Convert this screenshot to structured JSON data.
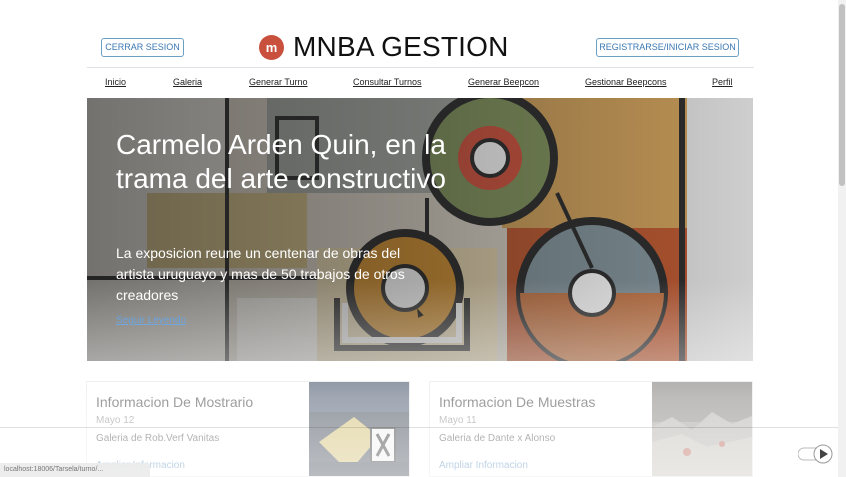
{
  "header": {
    "logout_label": "CERRAR SESION",
    "brand_logo": "m",
    "brand_title": "MNBA GESTION",
    "register_label": "REGISTRARSE/INICIAR SESION"
  },
  "nav": {
    "items": [
      {
        "label": "Inicio"
      },
      {
        "label": "Galeria"
      },
      {
        "label": "Generar Turno"
      },
      {
        "label": "Consultar Turnos"
      },
      {
        "label": "Generar Beepcon"
      },
      {
        "label": "Gestionar Beepcons"
      },
      {
        "label": "Perfil"
      }
    ]
  },
  "hero": {
    "title": "Carmelo Arden Quin, en la trama del arte constructivo",
    "text": "La exposicion reune un centenar de obras del artista uruguayo y mas de 50 trabajos de otros creadores",
    "link": "Seguir Leyendo"
  },
  "cards": [
    {
      "title": "Informacion De Mostrario",
      "date": "Mayo 12",
      "desc": "Galeria de Rob.Verf Vanitas",
      "link": "Ampliar Informacion"
    },
    {
      "title": "Informacion De Muestras",
      "date": "Mayo 11",
      "desc": "Galeria de Dante x Alonso",
      "link": "Ampliar Informacion"
    }
  ],
  "status_url": "localhost:18006/Tarsela/turno/...",
  "colors": {
    "accent_red": "#c9503c",
    "link_blue": "#3a78b3",
    "border_blue": "#6c9fc4"
  }
}
